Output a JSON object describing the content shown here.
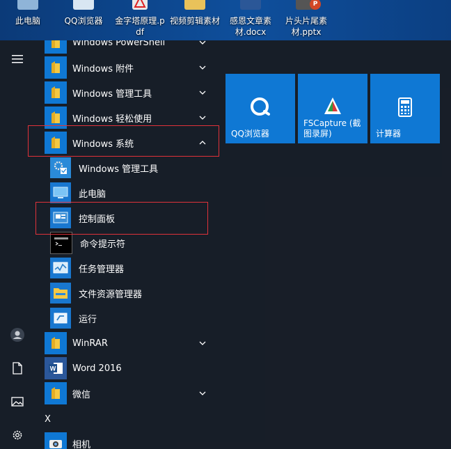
{
  "desktop": {
    "icons": [
      {
        "label": "此电脑"
      },
      {
        "label": "QQ浏览器"
      },
      {
        "label": "金字塔原理.pdf"
      },
      {
        "label": "视频剪辑素材"
      },
      {
        "label": "感恩文章素材.docx"
      },
      {
        "label": "片头片尾素材.pptx"
      }
    ]
  },
  "start_menu": {
    "apps": [
      {
        "label": "Windows PowerShell",
        "icon": "folder-icon",
        "expandable": true
      },
      {
        "label": "Windows 附件",
        "icon": "folder-icon",
        "expandable": true
      },
      {
        "label": "Windows 管理工具",
        "icon": "folder-icon",
        "expandable": true
      },
      {
        "label": "Windows 轻松使用",
        "icon": "folder-icon",
        "expandable": true
      },
      {
        "label": "Windows 系统",
        "icon": "folder-icon",
        "expanded": true
      },
      {
        "label": "Windows 管理工具",
        "icon": "admin-tools-icon"
      },
      {
        "label": "此电脑",
        "icon": "computer-icon"
      },
      {
        "label": "控制面板",
        "icon": "control-panel-icon"
      },
      {
        "label": "命令提示符",
        "icon": "command-prompt-icon"
      },
      {
        "label": "任务管理器",
        "icon": "task-manager-icon"
      },
      {
        "label": "文件资源管理器",
        "icon": "file-explorer-icon"
      },
      {
        "label": "运行",
        "icon": "run-icon"
      },
      {
        "label": "WinRAR",
        "icon": "folder-icon",
        "expandable": true
      },
      {
        "label": "Word 2016",
        "icon": "word-icon"
      },
      {
        "label": "微信",
        "icon": "folder-icon",
        "expandable": true
      },
      {
        "letter": "X"
      },
      {
        "label": "相机",
        "icon": "camera-icon"
      }
    ],
    "tiles": [
      {
        "label": "QQ浏览器",
        "icon": "qq-browser-icon"
      },
      {
        "label": "FSCapture (截图录屏)",
        "icon": "fscapture-icon"
      },
      {
        "label": "计算器",
        "icon": "calculator-icon"
      }
    ],
    "left_rail": [
      "hamburger-icon",
      "user-icon",
      "documents-icon",
      "pictures-icon",
      "settings-icon"
    ]
  },
  "colors": {
    "accent": "#0f78d4",
    "highlight_border": "#e0323a",
    "folder": "#f5c842"
  }
}
